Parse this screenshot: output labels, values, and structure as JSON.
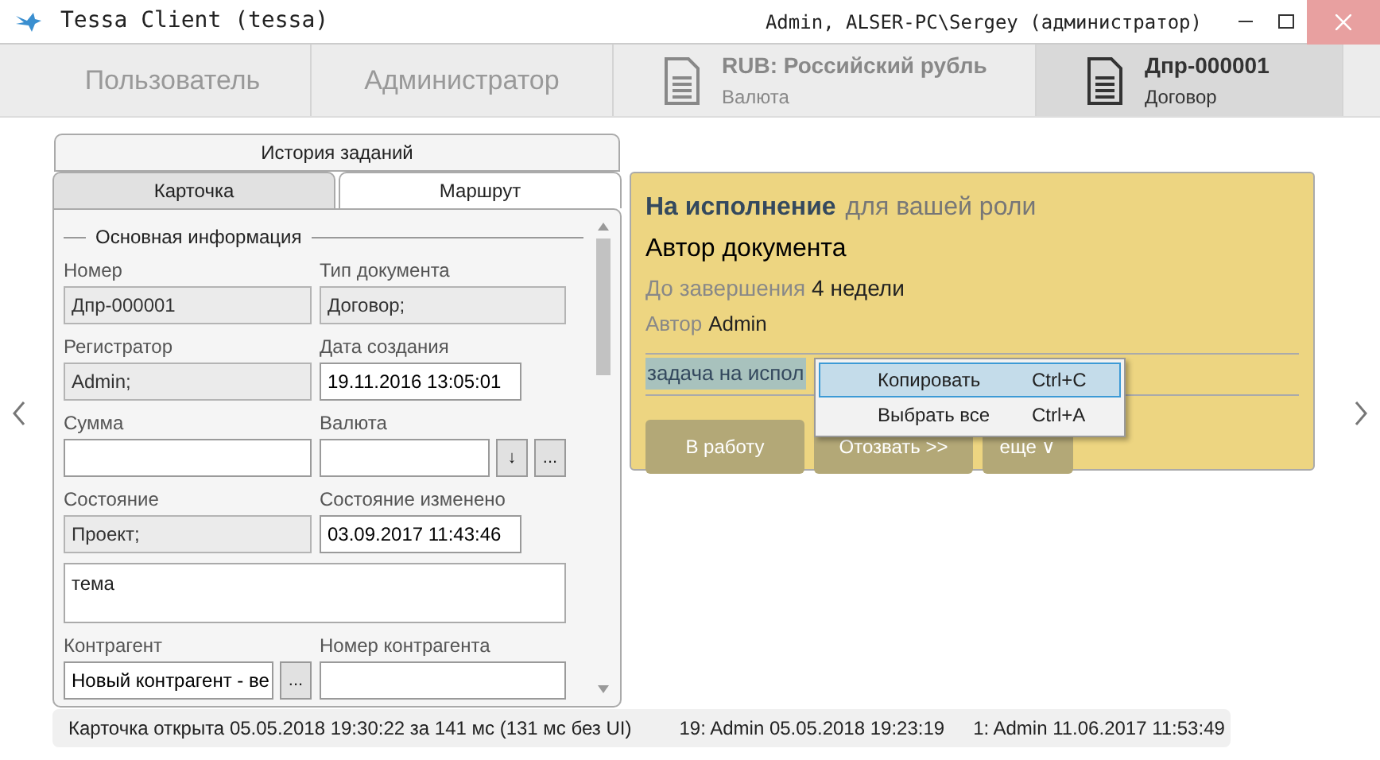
{
  "window": {
    "title": "Tessa Client (tessa)",
    "user": "Admin, ALSER-PC\\Sergey (администратор)"
  },
  "tabs": [
    {
      "kind": "plain",
      "title": "Пользователь",
      "selected": false
    },
    {
      "kind": "plain",
      "title": "Администратор",
      "selected": false
    },
    {
      "kind": "doc",
      "title": "RUB: Российский рубль",
      "subtitle": "Валюта",
      "selected": false
    },
    {
      "kind": "doc",
      "title": "Дпр-000001",
      "subtitle": "Договор",
      "selected": true
    }
  ],
  "history_tab": "История заданий",
  "card_tabs": [
    {
      "label": "Карточка",
      "selected": true
    },
    {
      "label": "Маршрут",
      "selected": false
    }
  ],
  "section": "Основная информация",
  "fields": [
    {
      "kind": "text",
      "label": "Номер",
      "value": "Дпр-000001",
      "readonly": true
    },
    {
      "kind": "text",
      "label": "Тип документа",
      "value": "Договор;",
      "readonly": true
    },
    {
      "kind": "text",
      "label": "Регистратор",
      "value": "Admin;",
      "readonly": true
    },
    {
      "kind": "date",
      "label": "Дата создания",
      "value": "19.11.2016  13:05:01",
      "readonly": false
    },
    {
      "kind": "text",
      "label": "Сумма",
      "readonly": false
    },
    {
      "kind": "ref",
      "label": "Валюта",
      "readonly": false,
      "buttons": [
        "↓",
        "..."
      ]
    },
    {
      "kind": "text",
      "label": "Состояние",
      "value": "Проект;",
      "readonly": true
    },
    {
      "kind": "date",
      "label": "Состояние изменено",
      "value": "03.09.2017  11:43:46",
      "readonly": false
    },
    {
      "kind": "memo",
      "value": "тема"
    },
    {
      "kind": "ref",
      "label": "Контрагент",
      "value": "Новый контрагент - ве",
      "readonly": false,
      "buttons": [
        "..."
      ]
    },
    {
      "kind": "text",
      "label": "Номер контрагента",
      "readonly": false
    }
  ],
  "task": {
    "state": "На исполнение",
    "role": "для вашей роли",
    "title": "Автор документа",
    "due_label": "До завершения",
    "due": "4 недели",
    "author_label": "Автор",
    "author": "Admin",
    "text": "задача на испол",
    "buttons": [
      "В работу",
      "Отозвать >>",
      "еще ∨"
    ]
  },
  "context_menu": [
    {
      "label": "Копировать",
      "shortcut": "Ctrl+C",
      "selected": true
    },
    {
      "label": "Выбрать все",
      "shortcut": "Ctrl+A",
      "selected": false
    }
  ],
  "status_bar": [
    "Карточка открыта 05.05.2018 19:30:22 за 141 мс (131 мс без UI)",
    "19:  Admin  05.05.2018 19:23:19",
    "1:  Admin  11.06.2017 11:53:49"
  ]
}
